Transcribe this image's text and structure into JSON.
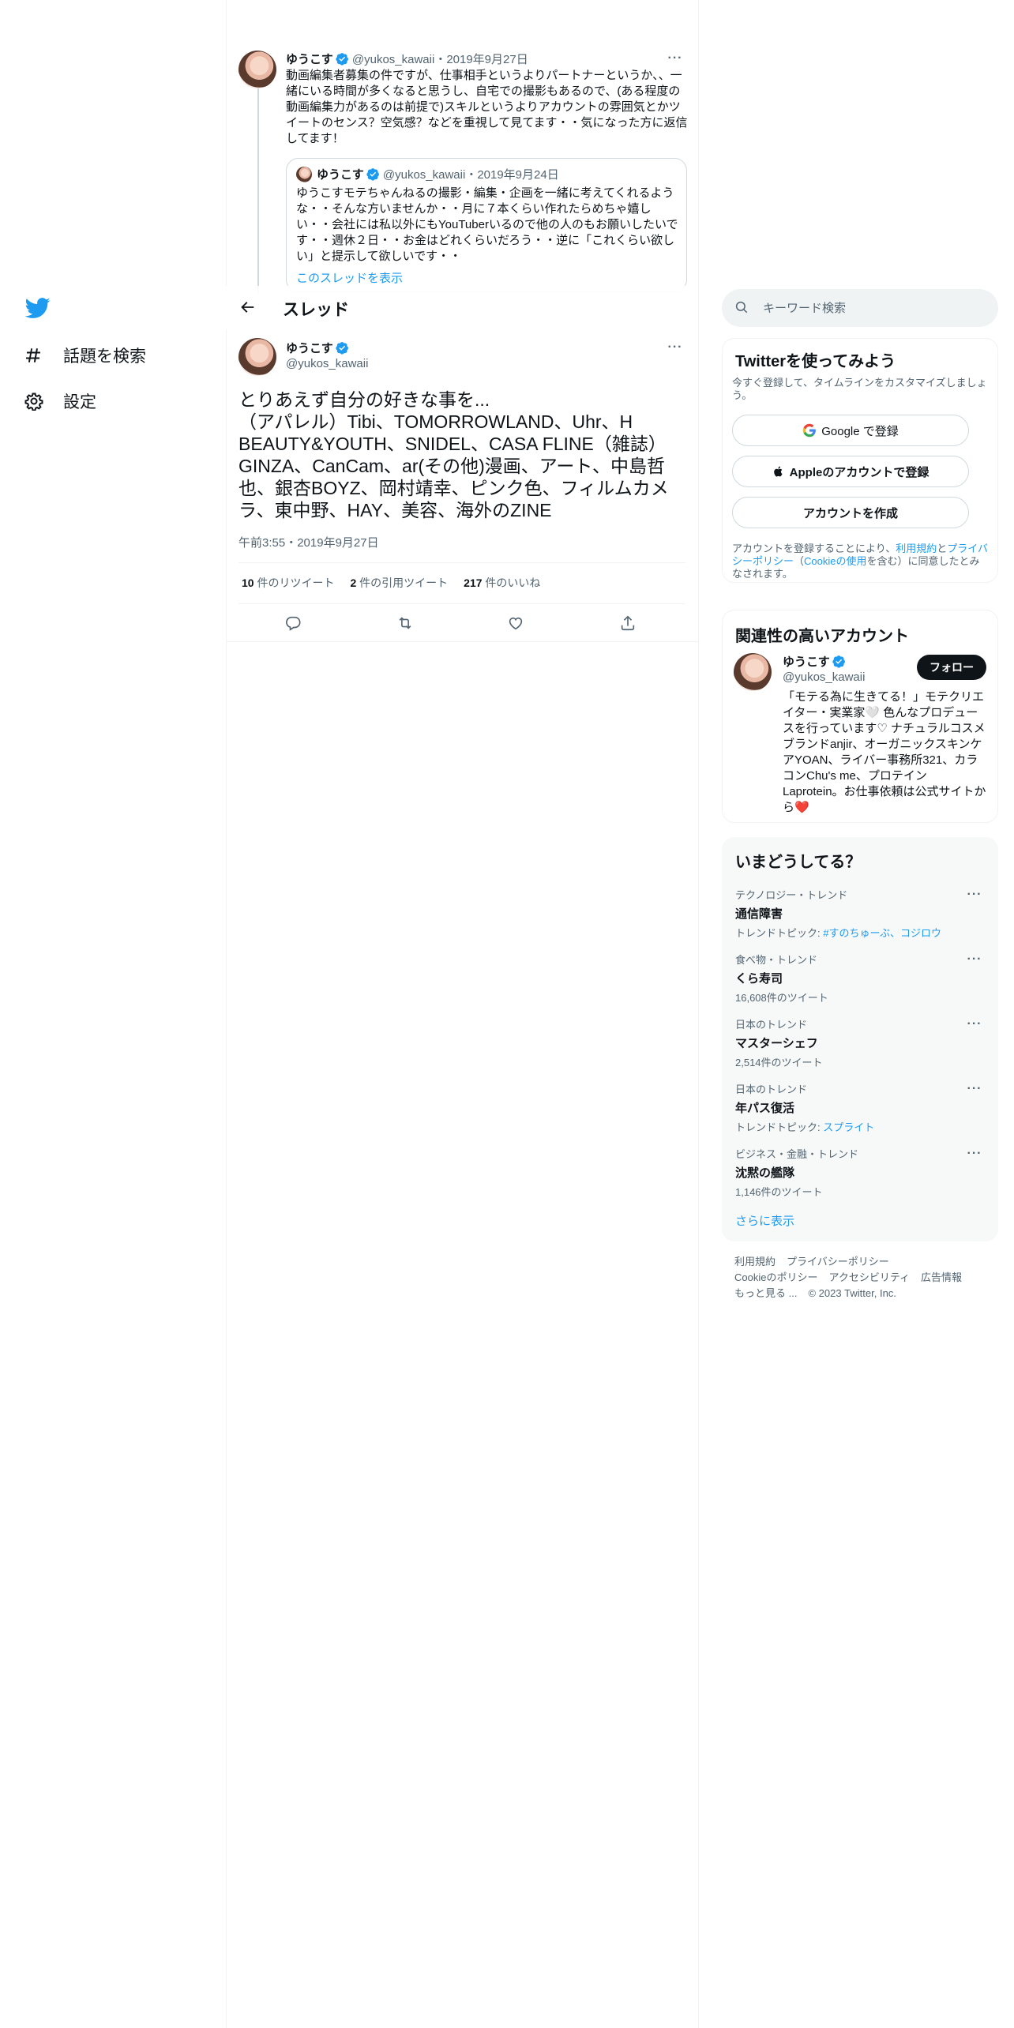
{
  "nav": {
    "items": [
      {
        "label": "話題を検索",
        "icon": "hashtag-icon"
      },
      {
        "label": "設定",
        "icon": "gear-icon"
      }
    ]
  },
  "thread_parent": {
    "name": "ゆうこす",
    "handle": "@yukos_kawaii",
    "date": "・2019年9月27日",
    "text": "動画編集者募集の件ですが、仕事相手というよりパートナーというか、、一緒にいる時間が多くなると思うし、自宅での撮影もあるので、(ある程度の動画編集力があるのは前提で)スキルというよりアカウントの雰囲気とかツイートのセンス？空気感？などを重視して見てます・・気になった方に返信してます！",
    "quote": {
      "name": "ゆうこす",
      "handle": "@yukos_kawaii",
      "date": "・2019年9月24日",
      "text": "ゆうこすモテちゃんねるの撮影・編集・企画を一緒に考えてくれるような・・そんな方いませんか・・月に７本くらい作れたらめちゃ嬉しい・・会社には私以外にもYouTuberいるので他の人のもお願いしたいです・・週休２日・・お金はどれくらいだろう・・逆に「これくらい欲しい」と提示して欲しいです・・",
      "show_thread": "このスレッドを表示"
    }
  },
  "header": {
    "title": "スレッド"
  },
  "main_tweet": {
    "name": "ゆうこす",
    "handle": "@yukos_kawaii",
    "text": "とりあえず自分の好きな事を...\n（アパレル）Tibi、TOMORROWLAND、Uhr、H BEAUTY&YOUTH、SNIDEL、CASA FLINE（雑誌）GINZA、CanCam、ar(その他)漫画、アート、中島哲也、銀杏BOYZ、岡村靖幸、ピンク色、フィルムカメラ、東中野、HAY、美容、海外のZINE",
    "time": "午前3:55・2019年9月27日",
    "stats": {
      "retweets": "10",
      "retweets_label": " 件のリツイート",
      "quotes": "2",
      "quotes_label": " 件の引用ツイート",
      "likes": "217",
      "likes_label": " 件のいいね"
    }
  },
  "search": {
    "placeholder": "キーワード検索"
  },
  "signup": {
    "title": "Twitterを使ってみよう",
    "desc": "今すぐ登録して、タイムラインをカスタマイズしましょう。",
    "google": "Google で登録",
    "apple": "Appleのアカウントで登録",
    "create": "アカウントを作成",
    "legal_1": "アカウントを登録することにより、",
    "legal_terms": "利用規約",
    "legal_2": "と",
    "legal_privacy": "プライバシーポリシー",
    "legal_3": "（",
    "legal_cookie": "Cookieの使用",
    "legal_4": "を含む）に同意したとみなされます。"
  },
  "relevant": {
    "title": "関連性の高いアカウント",
    "name": "ゆうこす",
    "handle": "@yukos_kawaii",
    "follow": "フォロー",
    "bio": "「モテる為に生きてる！」モテクリエイター・実業家🤍 色んなプロデュースを行っています♡ ナチュラルコスメブランドanjir、オーガニックスキンケアYOAN、ライバー事務所321、カラコンChu's me、プロテインLaprotein。お仕事依頼は公式サイトから",
    "bio_heart": "❤️"
  },
  "trends": {
    "title": "いまどうしてる？",
    "items": [
      {
        "context": "テクノロジー・トレンド",
        "title": "通信障害",
        "sub_label": "トレンドトピック: ",
        "sub_link": "#すのちゅーぶ、コジロウ"
      },
      {
        "context": "食べ物・トレンド",
        "title": "くら寿司",
        "sub": "16,608件のツイート"
      },
      {
        "context": "日本のトレンド",
        "title": "マスターシェフ",
        "sub": "2,514件のツイート"
      },
      {
        "context": "日本のトレンド",
        "title": "年パス復活",
        "sub_label": "トレンドトピック: ",
        "sub_link": "スプライト"
      },
      {
        "context": "ビジネス・金融・トレンド",
        "title": "沈黙の艦隊",
        "sub": "1,146件のツイート"
      }
    ],
    "show_more": "さらに表示"
  },
  "footer": {
    "terms": "利用規約",
    "privacy": "プライバシーポリシー",
    "cookie": "Cookieのポリシー",
    "accessibility": "アクセシビリティ",
    "ads": "広告情報",
    "more": "もっと見る ...",
    "copyright": "© 2023 Twitter, Inc."
  },
  "colors": {
    "accent": "#1d9bf0",
    "text": "#0f1419",
    "muted": "#536471"
  }
}
